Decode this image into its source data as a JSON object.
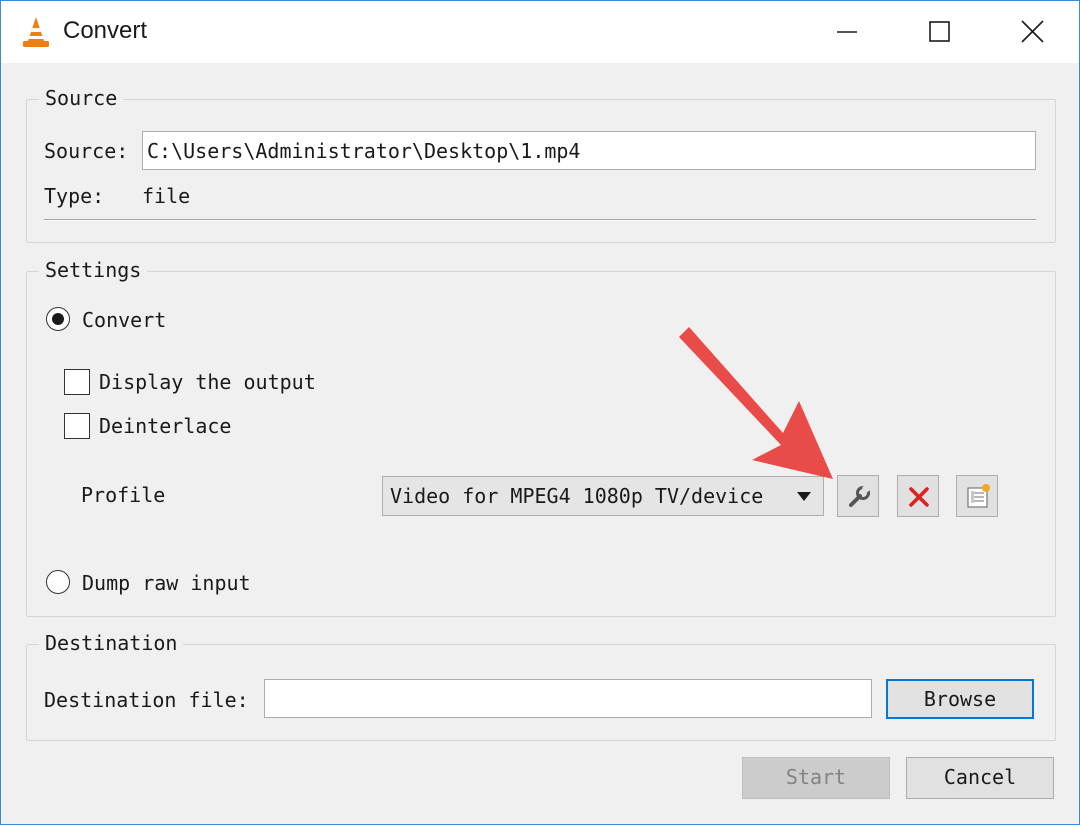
{
  "window": {
    "title": "Convert",
    "controls": {
      "minimize_icon": "minimize-icon",
      "maximize_icon": "maximize-icon",
      "close_icon": "close-icon"
    }
  },
  "source_group": {
    "title": "Source",
    "source_label": "Source:",
    "source_value": "C:\\Users\\Administrator\\Desktop\\1.mp4",
    "type_label": "Type:",
    "type_value": "file"
  },
  "settings_group": {
    "title": "Settings",
    "convert_radio": {
      "label": "Convert",
      "selected": true
    },
    "display_output_checkbox": {
      "label": "Display the output",
      "checked": false
    },
    "deinterlace_checkbox": {
      "label": "Deinterlace",
      "checked": false
    },
    "profile_label": "Profile",
    "profile_selected": "Video for MPEG4 1080p TV/device",
    "profile_buttons": {
      "edit_icon": "wrench-icon",
      "delete_icon": "red-x-icon",
      "new_icon": "new-profile-icon"
    },
    "dump_raw_radio": {
      "label": "Dump raw input",
      "selected": false
    }
  },
  "destination_group": {
    "title": "Destination",
    "destination_label": "Destination file:",
    "destination_value": "",
    "browse_label": "Browse"
  },
  "footer": {
    "start_label": "Start",
    "cancel_label": "Cancel"
  },
  "colors": {
    "window_border": "#3c8bd6",
    "annotation_arrow": "#e8413e",
    "delete_x": "#e02020",
    "focus_border": "#0078d7"
  }
}
